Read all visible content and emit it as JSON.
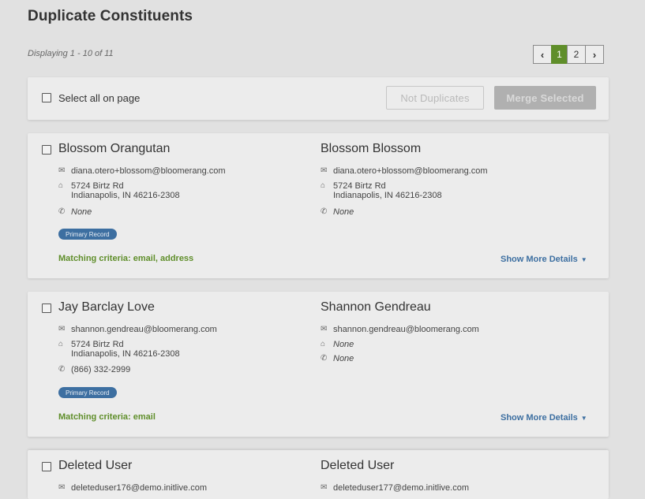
{
  "page": {
    "title": "Duplicate Constituents",
    "displaying": "Displaying 1 - 10 of 11"
  },
  "pager": {
    "prev": "‹",
    "pages": [
      "1",
      "2"
    ],
    "next": "›",
    "active_page": "1"
  },
  "toolbar": {
    "select_all_label": "Select all on page",
    "not_duplicates_label": "Not Duplicates",
    "merge_selected_label": "Merge Selected"
  },
  "icons": {
    "email": "✉",
    "address": "⌂",
    "phone": "✆",
    "prev": "chevron-left-icon",
    "next": "chevron-right-icon"
  },
  "colors": {
    "accent_green": "#5f8e2a",
    "accent_blue": "#3d6fa1"
  },
  "pairs": [
    {
      "left": {
        "name": "Blossom Orangutan",
        "email": "diana.otero+blossom@bloomerang.com",
        "address1": "5724 Birtz Rd",
        "address2": "Indianapolis, IN 46216-2308",
        "phone": "None"
      },
      "right": {
        "name": "Blossom Blossom",
        "email": "diana.otero+blossom@bloomerang.com",
        "address1": "5724 Birtz Rd",
        "address2": "Indianapolis, IN 46216-2308",
        "phone": "None"
      },
      "badge": "Primary Record",
      "criteria": "Matching criteria: email, address",
      "more": "Show More Details"
    },
    {
      "left": {
        "name": "Jay Barclay Love",
        "email": "shannon.gendreau@bloomerang.com",
        "address1": "5724 Birtz Rd",
        "address2": "Indianapolis, IN 46216-2308",
        "phone": "(866) 332-2999"
      },
      "right": {
        "name": "Shannon Gendreau",
        "email": "shannon.gendreau@bloomerang.com",
        "address1": "None",
        "phone": "None"
      },
      "badge": "Primary Record",
      "criteria": "Matching criteria: email",
      "more": "Show More Details"
    },
    {
      "left": {
        "name": "Deleted User",
        "email": "deleteduser176@demo.initlive.com"
      },
      "right": {
        "name": "Deleted User",
        "email": "deleteduser177@demo.initlive.com"
      }
    }
  ]
}
